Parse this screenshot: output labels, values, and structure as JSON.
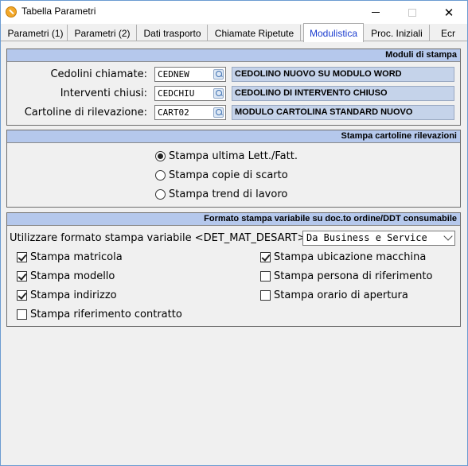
{
  "window": {
    "title": "Tabella Parametri"
  },
  "tabs": [
    {
      "label": "Parametri (1)"
    },
    {
      "label": "Parametri (2)"
    },
    {
      "label": "Dati trasporto"
    },
    {
      "label": "Chiamate Ripetute"
    },
    {
      "label": "Modulistica",
      "active": true
    },
    {
      "label": "Proc. Iniziali"
    },
    {
      "label": "Ecr"
    }
  ],
  "moduli": {
    "header": "Moduli di stampa",
    "rows": [
      {
        "label": "Cedolini chiamate:",
        "code": "CEDNEW",
        "description": "CEDOLINO NUOVO SU MODULO WORD"
      },
      {
        "label": "Interventi chiusi:",
        "code": "CEDCHIU",
        "description": "CEDOLINO DI INTERVENTO CHIUSO"
      },
      {
        "label": "Cartoline di rilevazione:",
        "code": "CART02",
        "description": "MODULO CARTOLINA STANDARD NUOVO"
      }
    ]
  },
  "cartoline": {
    "header": "Stampa cartoline rilevazioni",
    "options": [
      {
        "label": "Stampa ultima Lett./Fatt.",
        "checked": true
      },
      {
        "label": "Stampa copie di scarto",
        "checked": false
      },
      {
        "label": "Stampa trend di lavoro",
        "checked": false
      }
    ]
  },
  "formato": {
    "header": "Formato stampa variabile su doc.to ordine/DDT consumabile",
    "select_label": "Utilizzare formato stampa variabile <DET_MAT_DESART>:",
    "select_value": "Da Business e Service",
    "checks_left": [
      {
        "label": "Stampa matricola",
        "checked": true
      },
      {
        "label": "Stampa modello",
        "checked": true
      },
      {
        "label": "Stampa indirizzo",
        "checked": true
      },
      {
        "label": "Stampa riferimento contratto",
        "checked": false
      }
    ],
    "checks_right": [
      {
        "label": "Stampa ubicazione macchina",
        "checked": true
      },
      {
        "label": "Stampa persona di riferimento",
        "checked": false
      },
      {
        "label": "Stampa orario di apertura",
        "checked": false
      }
    ]
  }
}
